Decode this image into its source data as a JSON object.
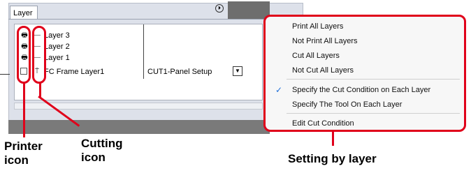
{
  "panel": {
    "tab_label": "Layer",
    "option_button_glyph": "⏵",
    "layers": [
      {
        "name": "Layer 3",
        "print_icon": "printer-icon",
        "cut_icon": "dash-icon",
        "cut_condition": ""
      },
      {
        "name": "Layer 2",
        "print_icon": "printer-icon",
        "cut_icon": "dash-icon",
        "cut_condition": ""
      },
      {
        "name": "Layer 1",
        "print_icon": "printer-icon",
        "cut_icon": "dash-icon",
        "cut_condition": ""
      },
      {
        "name": "FC Frame Layer1",
        "print_icon": "empty-box-icon",
        "cut_icon": "cutter-icon",
        "cut_condition": "CUT1-Panel Setup"
      }
    ],
    "dropdown_glyph": "▼"
  },
  "menu": {
    "items": [
      {
        "label": "Print All Layers",
        "checked": false
      },
      {
        "label": "Not Print All Layers",
        "checked": false
      },
      {
        "label": "Cut All Layers",
        "checked": false
      },
      {
        "label": "Not Cut All Layers",
        "checked": false
      },
      {
        "label": "Specify the Cut Condition on Each Layer",
        "checked": true
      },
      {
        "label": "Specify The Tool On Each Layer",
        "checked": false
      },
      {
        "label": "Edit Cut Condition",
        "checked": false
      }
    ],
    "check_glyph": "✓"
  },
  "captions": {
    "printer_line1": "Printer",
    "printer_line2": "icon",
    "cutting_line1": "Cutting",
    "cutting_line2": "icon",
    "setting": "Setting by layer"
  },
  "colors": {
    "accent_red": "#e0001a",
    "check_blue": "#1e6fd9"
  }
}
